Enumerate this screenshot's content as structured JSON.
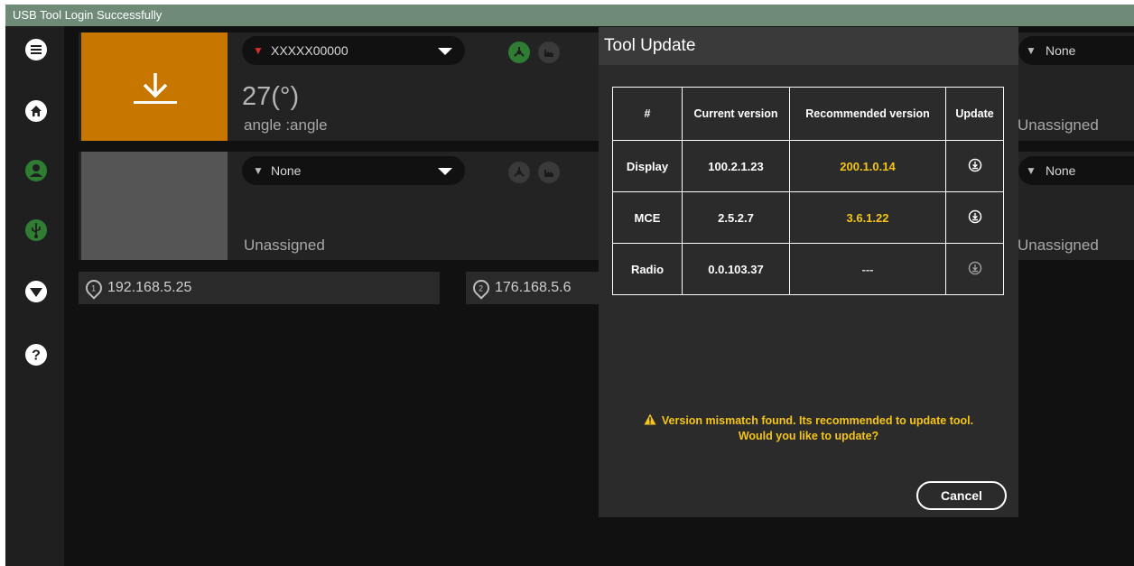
{
  "titlebar": {
    "text": "USB Tool Login Successfully"
  },
  "sidebar": {
    "icons": [
      "menu-icon",
      "home-icon",
      "user-icon",
      "usb-icon",
      "filter-icon",
      "help-icon"
    ],
    "active_color": "#2e7d32"
  },
  "tools": [
    {
      "name": "XXXXX00000",
      "value": "27(°)",
      "label": "angle :angle",
      "thumb_color": "#c77700",
      "right_name": "None",
      "right_label": "Unassigned"
    },
    {
      "name": "None",
      "value": "",
      "label": "Unassigned",
      "thumb_color": "#555555",
      "right_name": "None",
      "right_label": "Unassigned"
    }
  ],
  "controllers": [
    {
      "index": "1",
      "ip": "192.168.5.25"
    },
    {
      "index": "2",
      "ip": "176.168.5.6"
    }
  ],
  "dialog": {
    "title": "Tool Update",
    "headers": [
      "#",
      "Current version",
      "Recommended version",
      "Update"
    ],
    "rows": [
      {
        "name": "Display",
        "current": "100.2.1.23",
        "recommended": "200.1.0.14"
      },
      {
        "name": "MCE",
        "current": "2.5.2.7",
        "recommended": "3.6.1.22"
      },
      {
        "name": "Radio",
        "current": "0.0.103.37",
        "recommended": "---"
      }
    ],
    "warning_line1": "Version mismatch found. Its recommended to update tool.",
    "warning_line2": "Would you like to update?",
    "cancel_label": "Cancel"
  },
  "colors": {
    "accent_yellow": "#f5c518",
    "titlebar": "#6f8b78",
    "tool_active": "#c77700"
  }
}
